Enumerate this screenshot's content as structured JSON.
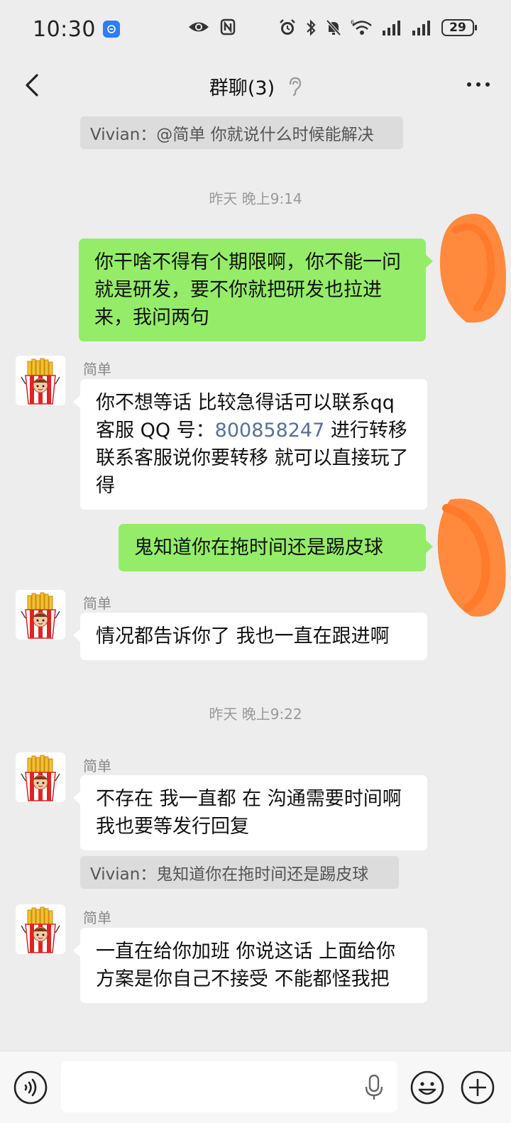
{
  "status_bar": {
    "time": "10:30",
    "battery": "29"
  },
  "header": {
    "title": "群聊(3)"
  },
  "chat": {
    "quote_top": "Vivian：@简单 你就说什么时候能解决",
    "time_1": "昨天 晚上9:14",
    "msg_me_1": "你干啥不得有个期限啊，你不能一问就是研发，要不你就把研发也拉进来，我问两句",
    "sender_1": "简单",
    "msg_jd_1_a": "你不想等话  比较急得话可以联系qq 客服 QQ 号：",
    "msg_jd_1_qq": "800858247",
    "msg_jd_1_b": "   进行转移  联系客服说你要转移 就可以直接玩了得",
    "msg_me_2": "鬼知道你在拖时间还是踢皮球",
    "sender_2": "简单",
    "msg_jd_2": "情况都告诉你了 我也一直在跟进啊",
    "time_2": "昨天 晚上9:22",
    "sender_3": "简单",
    "msg_jd_3": "不存在 我一直都 在  沟通需要时间啊  我也要等发行回复",
    "quote_mid": "Vivian：鬼知道你在拖时间还是踢皮球",
    "sender_4": "简单",
    "msg_jd_4": "一直在给你加班 你说这话   上面给你方案是你自己不接受 不能都怪我把"
  },
  "colors": {
    "background": "#ededed",
    "bubble_self": "#95ec69",
    "bubble_other": "#ffffff",
    "scribble": "#ff8a3d",
    "link": "#5a6f95"
  },
  "icons": [
    "back-icon",
    "ear-icon",
    "more-icon",
    "voice-icon",
    "mic-icon",
    "emoji-icon",
    "plus-icon",
    "fries-avatar"
  ]
}
